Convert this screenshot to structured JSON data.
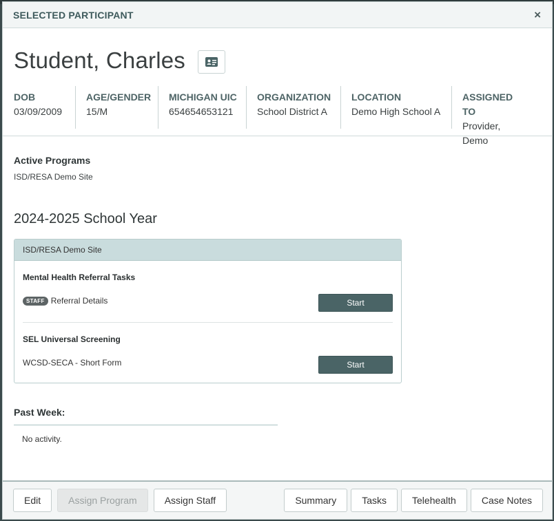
{
  "modal": {
    "title": "SELECTED PARTICIPANT",
    "close_glyph": "×"
  },
  "participant": {
    "name": "Student, Charles",
    "card_icon": "id-card-icon",
    "fields": [
      {
        "label": "DOB",
        "value": "03/09/2009"
      },
      {
        "label": "AGE/GENDER",
        "value": "15/M"
      },
      {
        "label": "MICHIGAN UIC",
        "value": "654654653121"
      },
      {
        "label": "ORGANIZATION",
        "value": "School District A"
      },
      {
        "label": "LOCATION",
        "value": "Demo High School A"
      },
      {
        "label": "ASSIGNED TO",
        "value": "Provider, Demo"
      }
    ]
  },
  "active_programs": {
    "heading": "Active Programs",
    "items": [
      "ISD/RESA Demo Site"
    ]
  },
  "school_year": {
    "heading": "2024-2025 School Year",
    "program": {
      "name": "ISD/RESA Demo Site",
      "tasks": [
        {
          "title": "Mental Health Referral Tasks",
          "badge": "STAFF",
          "subtitle": "Referral Details",
          "button": "Start"
        },
        {
          "title": "SEL Universal Screening",
          "badge": "",
          "subtitle": "WCSD-SECA - Short Form",
          "button": "Start"
        }
      ]
    }
  },
  "past_week": {
    "heading": "Past Week:",
    "empty_text": "No activity."
  },
  "footer": {
    "left": [
      "Edit",
      "Assign Program",
      "Assign Staff"
    ],
    "right": [
      "Summary",
      "Tasks",
      "Telehealth",
      "Case Notes"
    ],
    "disabled": [
      "Assign Program"
    ]
  },
  "colors": {
    "primary_button": "#4a6466",
    "card_header": "#c9dcdd",
    "label_text": "#4e6466"
  }
}
